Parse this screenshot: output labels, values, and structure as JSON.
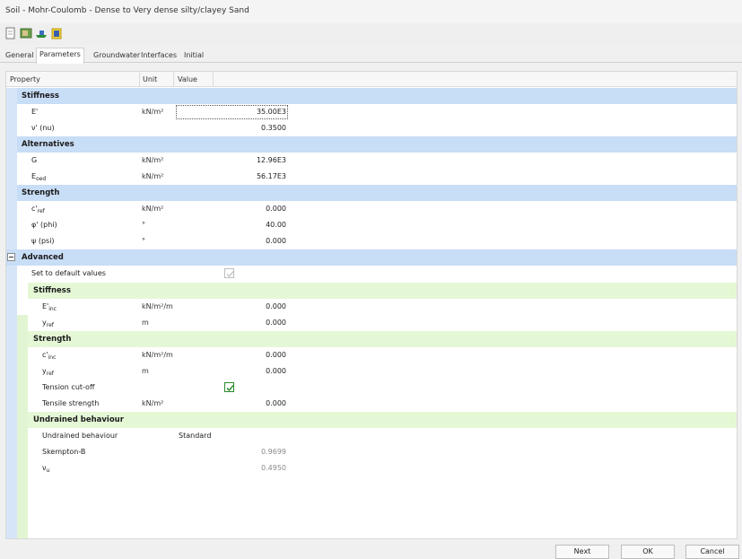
{
  "window": {
    "title": "Soil - Mohr-Coulomb - Dense to Very dense silty/clayey Sand"
  },
  "toolbar": {
    "icons": [
      "new-icon",
      "open-icon",
      "ship-icon",
      "clipboard-icon"
    ]
  },
  "tabs": [
    "General",
    "Parameters",
    "Groundwater",
    "Interfaces",
    "Initial"
  ],
  "grid": {
    "headers": {
      "property": "Property",
      "unit": "Unit",
      "value": "Value"
    },
    "stiffness": {
      "title": "Stiffness",
      "e": {
        "label": "E'",
        "unit": "kN/m²",
        "value": "35.00E3"
      },
      "nu": {
        "label": "ν' (nu)",
        "value": "0.3500"
      }
    },
    "alternatives": {
      "title": "Alternatives",
      "g": {
        "label": "G",
        "unit": "kN/m²",
        "value": "12.96E3"
      },
      "eoed": {
        "label": "E",
        "sub": "oed",
        "unit": "kN/m²",
        "value": "56.17E3"
      }
    },
    "strength": {
      "title": "Strength",
      "cref": {
        "label": "c'",
        "sub": "ref",
        "unit": "kN/m²",
        "value": "0.000"
      },
      "phi": {
        "label": "φ' (phi)",
        "unit": "°",
        "value": "40.00"
      },
      "psi": {
        "label": "ψ (psi)",
        "unit": "°",
        "value": "0.000"
      }
    },
    "advanced": {
      "title": "Advanced",
      "set_default": {
        "label": "Set to default values",
        "checked": true
      },
      "stiffness": {
        "title": "Stiffness",
        "einc": {
          "label": "E'",
          "sub": "inc",
          "unit": "kN/m²/m",
          "value": "0.000"
        },
        "yref": {
          "label": "y",
          "sub": "ref",
          "unit": "m",
          "value": "0.000"
        }
      },
      "strength": {
        "title": "Strength",
        "cinc": {
          "label": "c'",
          "sub": "inc",
          "unit": "kN/m²/m",
          "value": "0.000"
        },
        "yref": {
          "label": "y",
          "sub": "ref",
          "unit": "m",
          "value": "0.000"
        },
        "tension_cutoff": {
          "label": "Tension cut-off",
          "checked": true
        },
        "tensile_strength": {
          "label": "Tensile strength",
          "unit": "kN/m²",
          "value": "0.000"
        }
      },
      "undrained": {
        "title": "Undrained behaviour",
        "behaviour": {
          "label": "Undrained behaviour",
          "value": "Standard"
        },
        "skempton": {
          "label": "Skempton-B",
          "value": "0.9699"
        },
        "nu_u": {
          "label": "ν",
          "sub": "u",
          "value": "0.4950"
        }
      }
    }
  },
  "buttons": {
    "next": "Next",
    "ok": "OK",
    "cancel": "Cancel"
  },
  "colors": {
    "group_blue": "#c8ddf6",
    "group_green": "#e5f8d6",
    "check_green": "#2a8a2a"
  }
}
